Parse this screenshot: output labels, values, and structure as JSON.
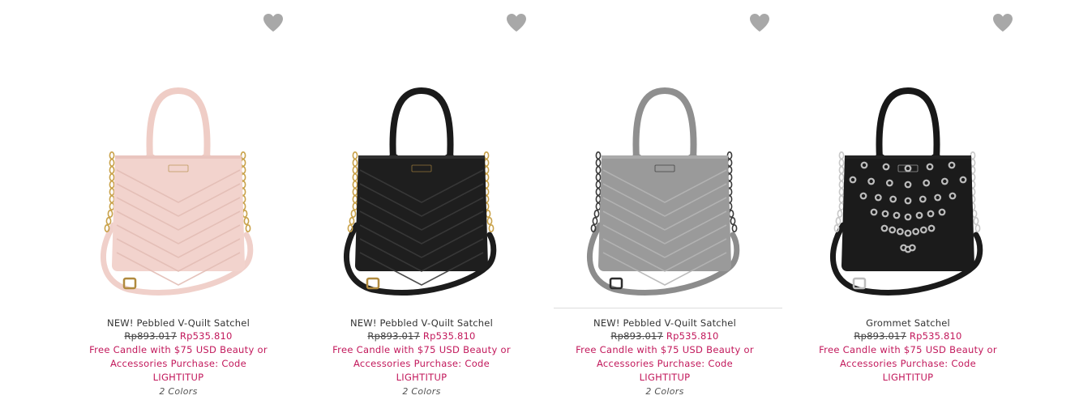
{
  "products": [
    {
      "name": "NEW! Pebbled V-Quilt Satchel",
      "old_price": "Rp893.017",
      "sale_price": "Rp535.810",
      "promo_line1": "Free Candle with $75 USD Beauty or",
      "promo_line2": "Accessories Purchase: Code",
      "promo_line3": "LIGHTITUP",
      "colors": "2 Colors",
      "bag_color": "#f2d3cd",
      "handle_color": "#efcdc6",
      "strap_color": "#f0d0ca",
      "quilt_color": "#e3bdb5",
      "chain_color": "#c9a24a",
      "hardware_color": "#b08a3e",
      "style": "quilt",
      "favorite_icon": "heart-icon"
    },
    {
      "name": "NEW! Pebbled V-Quilt Satchel",
      "old_price": "Rp893.017",
      "sale_price": "Rp535.810",
      "promo_line1": "Free Candle with $75 USD Beauty or",
      "promo_line2": "Accessories Purchase: Code",
      "promo_line3": "LIGHTITUP",
      "colors": "2 Colors",
      "bag_color": "#1e1e1e",
      "handle_color": "#1a1a1a",
      "strap_color": "#1c1c1c",
      "quilt_color": "#3a3a3a",
      "chain_color": "#c9a24a",
      "hardware_color": "#b08a3e",
      "style": "quilt",
      "favorite_icon": "heart-icon"
    },
    {
      "name": "NEW! Pebbled V-Quilt Satchel",
      "old_price": "Rp893.017",
      "sale_price": "Rp535.810",
      "promo_line1": "Free Candle with $75 USD Beauty or",
      "promo_line2": "Accessories Purchase: Code",
      "promo_line3": "LIGHTITUP",
      "colors": "2 Colors",
      "bag_color": "#9a9a9a",
      "handle_color": "#8f8f8f",
      "strap_color": "#8c8c8c",
      "quilt_color": "#b5b5b5",
      "chain_color": "#3a3a3a",
      "hardware_color": "#2e2e2e",
      "style": "quilt",
      "favorite_icon": "heart-icon"
    },
    {
      "name": "Grommet Satchel",
      "old_price": "Rp893.017",
      "sale_price": "Rp535.810",
      "promo_line1": "Free Candle with $75 USD Beauty or",
      "promo_line2": "Accessories Purchase: Code",
      "promo_line3": "LIGHTITUP",
      "colors": "",
      "bag_color": "#1b1b1b",
      "handle_color": "#181818",
      "strap_color": "#1a1a1a",
      "quilt_color": "#2a2a2a",
      "chain_color": "#c8c8c8",
      "hardware_color": "#bdbdbd",
      "style": "grommet",
      "favorite_icon": "heart-icon"
    }
  ],
  "colors": {
    "heart": "#a8a8a8",
    "sale_price": "#c2185b",
    "promo": "#c2185b",
    "text": "#333333"
  }
}
